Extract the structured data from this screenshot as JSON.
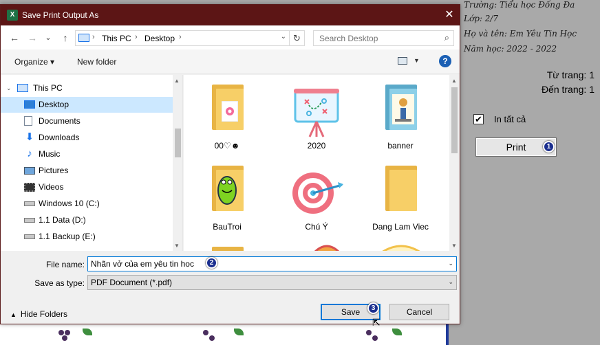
{
  "background": {
    "handwritten": [
      "Trường: Tiểu học Đống Đa",
      "Lớp:    2/7",
      "Họ và tên: Em Yêu Tin Học",
      "Năm học: 2022 - 2022"
    ],
    "range_from": "Từ trang: 1",
    "range_to": "Đến trang: 1",
    "print_all_check": "✔",
    "print_all_label": "In tất cả",
    "print_button": "Print",
    "badge_1": "1"
  },
  "dialog": {
    "title": "Save Print Output As",
    "app_icon": "X",
    "close_glyph": "✕"
  },
  "navbar": {
    "back_glyph": "←",
    "forward_glyph": "→",
    "recent_glyph": "⌄",
    "up_glyph": "↑",
    "path": [
      "This PC",
      "Desktop"
    ],
    "sep_glyph": "›",
    "refresh_glyph": "↻",
    "search_placeholder": "Search Desktop",
    "search_glyph": "⌕"
  },
  "toolbar": {
    "organize": "Organize ▾",
    "new_folder": "New folder",
    "help": "?"
  },
  "sidebar": {
    "items": [
      {
        "label": "This PC",
        "icon": "computer-icon"
      },
      {
        "label": "Desktop",
        "icon": "desktop-icon",
        "selected": true
      },
      {
        "label": "Documents",
        "icon": "documents-icon"
      },
      {
        "label": "Downloads",
        "icon": "downloads-icon"
      },
      {
        "label": "Music",
        "icon": "music-icon"
      },
      {
        "label": "Pictures",
        "icon": "pictures-icon"
      },
      {
        "label": "Videos",
        "icon": "videos-icon"
      },
      {
        "label": "Windows 10 (C:)",
        "icon": "drive-icon"
      },
      {
        "label": "1.1 Data (D:)",
        "icon": "drive-icon"
      },
      {
        "label": "1.1 Backup (E:)",
        "icon": "drive-icon"
      }
    ]
  },
  "files": [
    {
      "name": "00♡☻",
      "icon": "folder-icon"
    },
    {
      "name": "2020",
      "icon": "presentation-icon"
    },
    {
      "name": "banner",
      "icon": "folder-icon"
    },
    {
      "name": "BauTroi",
      "icon": "folder-icon"
    },
    {
      "name": "Chú Ý",
      "icon": "target-icon"
    },
    {
      "name": "Dang Lam Viec",
      "icon": "folder-icon"
    }
  ],
  "form": {
    "file_name_label": "File name:",
    "file_name_value": "Nhãn vở của em yêu tin hoc",
    "save_type_label": "Save as type:",
    "save_type_value": "PDF Document (*.pdf)",
    "dropdown_glyph": "⌄",
    "badge_2": "2"
  },
  "footer": {
    "hide_folders": "Hide Folders",
    "save": "Save",
    "cancel": "Cancel",
    "badge_3": "3"
  },
  "colors": {
    "titlebar": "#5c1515",
    "selection": "#cce8ff",
    "accent": "#0078d7",
    "badge": "#1b2f8f"
  }
}
